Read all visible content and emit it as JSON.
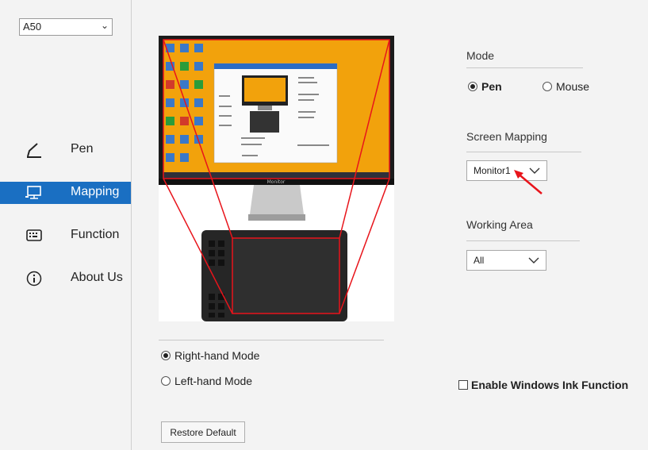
{
  "sidebar": {
    "device": "A50",
    "items": [
      {
        "label": "Pen",
        "icon": "pen-icon"
      },
      {
        "label": "Mapping",
        "icon": "monitor-icon",
        "active": true
      },
      {
        "label": "Function",
        "icon": "keyboard-icon"
      },
      {
        "label": "About Us",
        "icon": "info-icon"
      }
    ]
  },
  "preview": {
    "monitor_brand": "Monitor"
  },
  "mode": {
    "heading": "Mode",
    "options": [
      "Pen",
      "Mouse"
    ],
    "selected": "Pen"
  },
  "screen_mapping": {
    "heading": "Screen Mapping",
    "value": "Monitor1"
  },
  "working_area": {
    "heading": "Working Area",
    "value": "All"
  },
  "hand_mode": {
    "options": [
      "Right-hand Mode",
      "Left-hand Mode"
    ],
    "selected": "Right-hand Mode"
  },
  "windows_ink": {
    "label": "Enable Windows Ink Function",
    "checked": false
  },
  "restore_label": "Restore Default",
  "colors": {
    "accent": "#1a6fc2",
    "mapping_lines": "#e8141b",
    "desktop": "#f2a20c"
  }
}
